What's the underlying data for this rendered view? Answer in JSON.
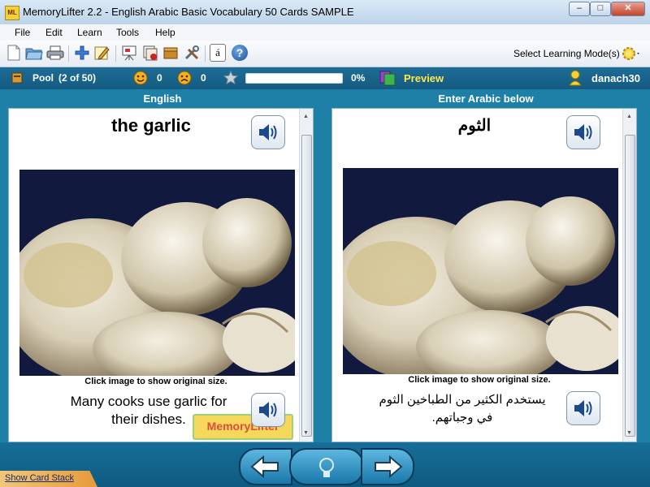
{
  "window": {
    "title": "MemoryLifter 2.2 - English Arabic Basic Vocabulary 50 Cards SAMPLE",
    "app_icon_text": "ML",
    "minimize": "–",
    "maximize": "□",
    "close": "✕"
  },
  "menu": [
    "File",
    "Edit",
    "Learn",
    "Tools",
    "Help"
  ],
  "toolbar": {
    "icons": [
      "new-file",
      "open-folder",
      "print",
      "add-card",
      "edit-card",
      "presentation",
      "card-stack",
      "box",
      "tools",
      "accent-a",
      "help"
    ],
    "accent_label": "á",
    "help_label": "?",
    "select_mode_label": "Select Learning Mode(s)"
  },
  "status": {
    "pool_label": "Pool",
    "pool_count": "(2 of 50)",
    "happy_count": "0",
    "sad_count": "0",
    "progress_percent": "0%",
    "progress_value": 0,
    "preview_label": "Preview",
    "username": "danach30"
  },
  "columns": {
    "left_header": "English",
    "right_header": "Enter Arabic below"
  },
  "cards": {
    "question": {
      "word": "the garlic",
      "caption": "Click image to show original size.",
      "example_line1": "Many cooks use garlic for",
      "example_line2": "their dishes.",
      "watermark": "MemoryLifter"
    },
    "answer": {
      "word": "الثوم",
      "caption": "Click image to show original size.",
      "example_line1": "يستخدم الكثير من الطباخين الثوم",
      "example_line2": "في وجباتهم."
    }
  },
  "bottom": {
    "show_card_stack": "Show Card Stack"
  },
  "colors": {
    "frame": "#1e7fa7",
    "status_bar": "#1a6690",
    "preview": "#ffe64a",
    "photo_dark": "#12193e"
  }
}
